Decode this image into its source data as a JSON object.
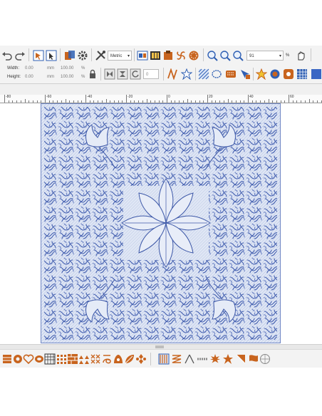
{
  "toolbar": {
    "units_select": "Metric",
    "zoom_value": "91",
    "zoom_unit": "%"
  },
  "size_panel": {
    "width_label": "Width:",
    "width_value": "0.00",
    "width_unit": "mm",
    "width_percent": "100.00",
    "height_label": "Height:",
    "height_value": "0.00",
    "height_unit": "mm",
    "height_percent": "100.00",
    "percent_sign": "%",
    "angle_value": "0"
  },
  "ruler": {
    "labels": [
      "-80",
      "-60",
      "-40",
      "-20",
      "0",
      "20",
      "40",
      "60"
    ]
  },
  "colors": {
    "toolbar_bg": "#f3f3f3",
    "stitch_blue": "#4460b0",
    "fill_blue": "#d9e2f6",
    "accent_orange": "#c8641e",
    "icon_blue": "#2f5fb3"
  },
  "icons": {
    "top_row": [
      "undo-icon",
      "redo-icon",
      "select-object-icon",
      "select-icon",
      "color-sequence-icon",
      "gear-icon",
      "tools-icon",
      "view-icon",
      "film-icon",
      "design-icon",
      "wind-icon",
      "pattern-icon",
      "zoom-fit-icon",
      "zoom-in-icon",
      "zoom-out-icon",
      "hand-icon"
    ],
    "bottom_row": [
      "fill-stitch-icon",
      "heart-icon",
      "motif-icon",
      "grid-icon",
      "cross-stitch-icon",
      "applique-icon",
      "satin-icon",
      "triangle-icon",
      "line-icon",
      "star-icon",
      "circle-icon"
    ]
  }
}
